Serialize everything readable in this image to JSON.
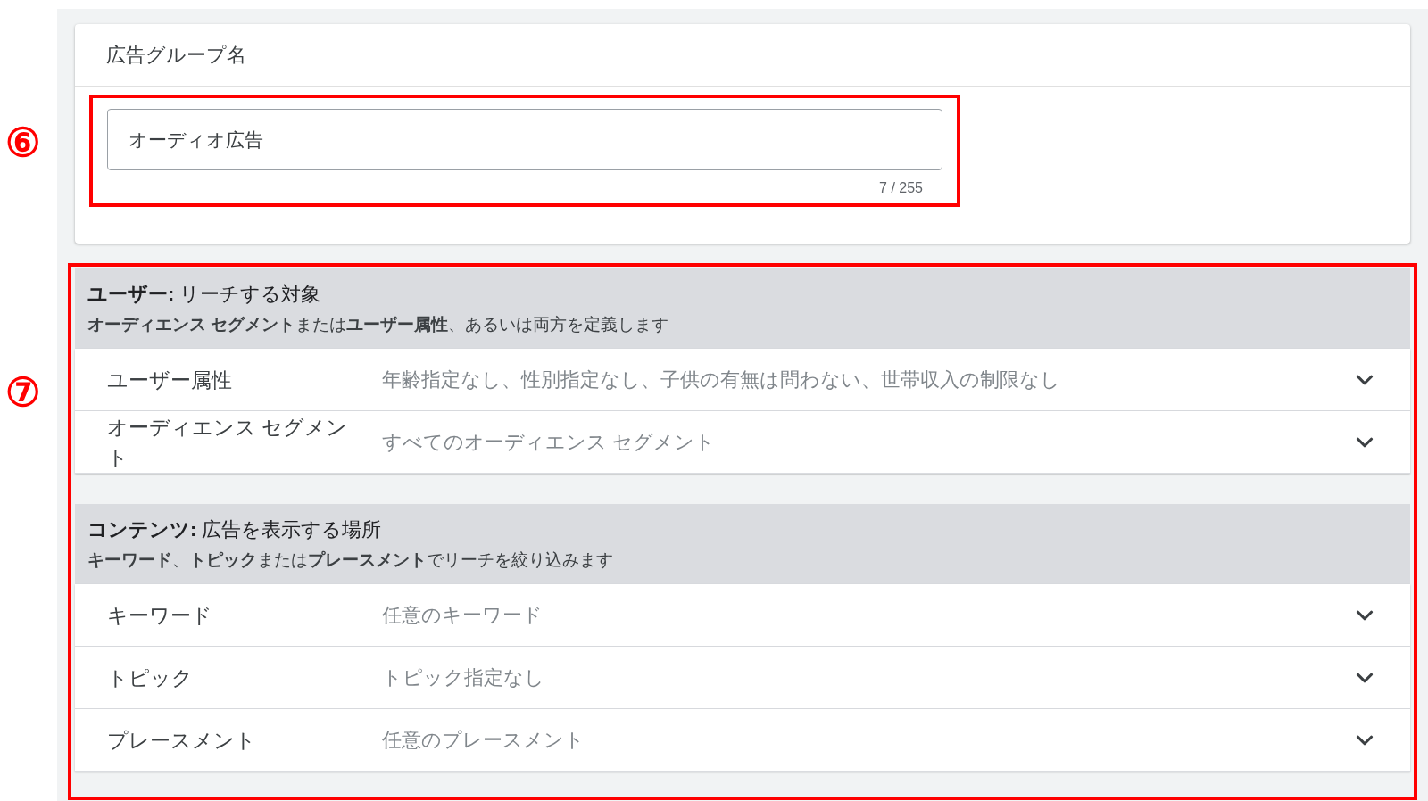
{
  "ad_group_name": {
    "marker": "⑥",
    "title": "広告グループ名",
    "input": {
      "value": "オーディオ広告"
    },
    "counter": "7 / 255"
  },
  "targeting": {
    "marker": "⑦",
    "sections": [
      {
        "title": "**ユーザー:** リーチする対象",
        "subtitle": "**オーディエンス セグメント**または**ユーザー属性**、あるいは両方を定義します",
        "rows": [
          {
            "label": "ユーザー属性",
            "value": "年齢指定なし、性別指定なし、子供の有無は問わない、世帯収入の制限なし"
          },
          {
            "label": "オーディエンス セグメント",
            "value": "すべてのオーディエンス セグメント"
          }
        ]
      },
      {
        "title": "**コンテンツ:** 広告を表示する場所",
        "subtitle": "**キーワード**、**トピック**または**プレースメント**でリーチを絞り込みます",
        "rows": [
          {
            "label": "キーワード",
            "value": "任意のキーワード"
          },
          {
            "label": "トピック",
            "value": "トピック指定なし"
          },
          {
            "label": "プレースメント",
            "value": "任意のプレースメント"
          }
        ]
      }
    ]
  }
}
